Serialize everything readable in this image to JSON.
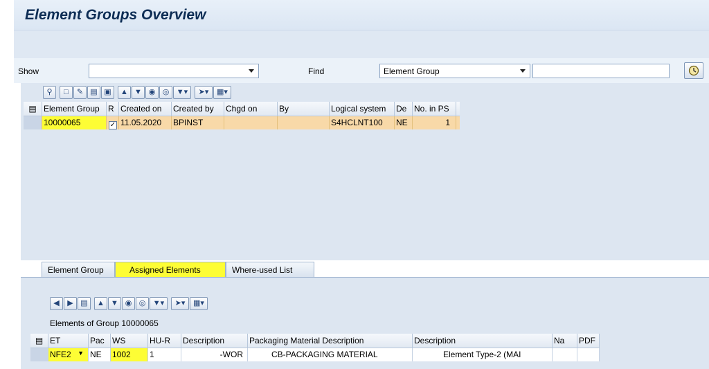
{
  "title": "Element Groups Overview",
  "filter": {
    "show_label": "Show",
    "show_value": "",
    "find_label": "Find",
    "find_value": "Element Group",
    "find_text": ""
  },
  "upper_grid": {
    "headers": [
      "Element Group",
      "R",
      "Created on",
      "Created by",
      "Chgd on",
      "By",
      "Logical system",
      "De",
      "No. in PS"
    ],
    "rows": [
      {
        "element_group": "10000065",
        "r": "✓",
        "created_on": "11.05.2020",
        "created_by": "BPINST",
        "chgd_on": "",
        "by": "",
        "logical_system": "S4HCLNT100",
        "de": "NE",
        "no_in_ps": "1"
      }
    ]
  },
  "tabs": [
    {
      "label": "Element Group"
    },
    {
      "label": "Assigned Elements"
    },
    {
      "label": "Where-used List"
    }
  ],
  "lower": {
    "caption": "Elements of  Group 10000065",
    "headers": [
      "ET",
      "Pac",
      "WS",
      "HU-R",
      "Description",
      "Packaging Material Description",
      "Description",
      "Na",
      "PDF"
    ],
    "rows": [
      {
        "et": "NFE2",
        "pac": "NE",
        "ws": "1002",
        "hu_r": "1",
        "desc1": "-WOR",
        "pack_desc": "CB-PACKAGING MATERIAL",
        "desc2": "Element Type-2 (MAI",
        "na": "",
        "pdf": ""
      }
    ]
  },
  "colors": {
    "highlight": "#fdfd35",
    "selected_row": "#f8d9a8",
    "title_text": "#0d2d55",
    "panel_bg": "#dde6f1"
  },
  "icons": {
    "execute": "clock-execute-icon",
    "details": "magnifier-icon",
    "create": "new-document-icon",
    "change": "pencil-icon",
    "delete": "trash-icon",
    "save": "save-icon",
    "sort_asc": "sort-ascending-icon",
    "sort_desc": "sort-descending-icon",
    "find": "binoculars-icon",
    "find_next": "binoculars-next-icon",
    "filter": "filter-icon",
    "export": "export-icon",
    "layout": "layout-grid-icon",
    "prev": "arrow-left-icon",
    "next": "arrow-right-icon"
  }
}
